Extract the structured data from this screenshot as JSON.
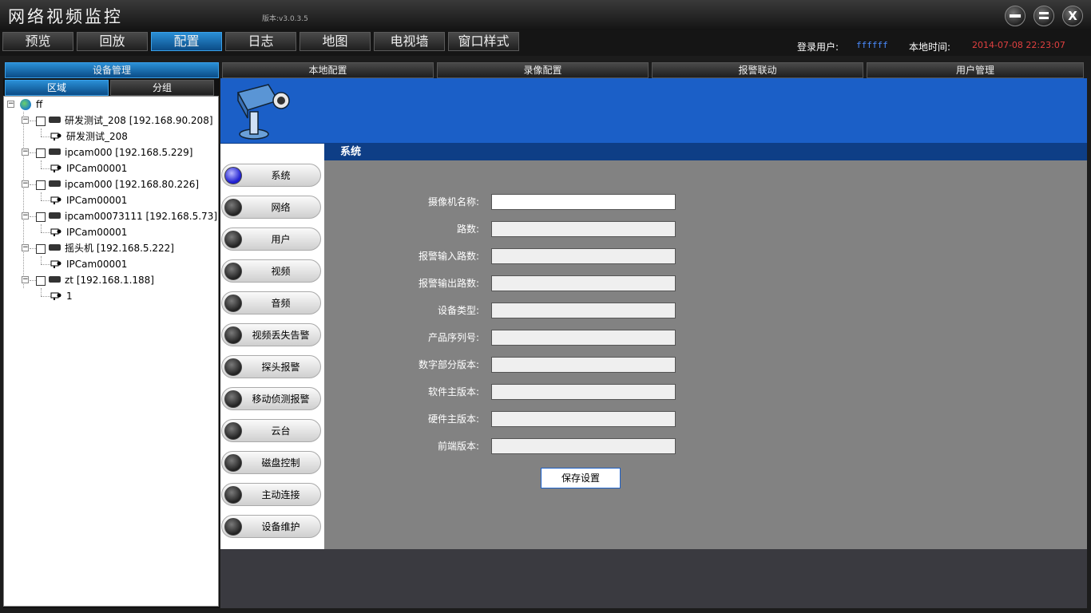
{
  "window": {
    "title": "网络视频监控",
    "version": "版本:v3.0.3.5",
    "min_icon": "minimize-icon",
    "restore_icon": "restore-icon",
    "close_label": "X"
  },
  "nav": {
    "tabs": [
      "预览",
      "回放",
      "配置",
      "日志",
      "地图",
      "电视墙",
      "窗口样式"
    ],
    "active": "配置",
    "user_label": "登录用户:",
    "user_value": "ffffff",
    "time_label": "本地时间:",
    "time_value": "2014-07-08 22:23:07"
  },
  "subtabs": [
    "设备管理",
    "本地配置",
    "录像配置",
    "报警联动",
    "用户管理"
  ],
  "left": {
    "tabs": [
      "区域",
      "分组"
    ],
    "root": "ff",
    "devices": [
      {
        "name": "研发测试_208 [192.168.90.208]",
        "channel": "研发测试_208"
      },
      {
        "name": "ipcam000 [192.168.5.229]",
        "channel": "IPCam00001"
      },
      {
        "name": "ipcam000 [192.168.80.226]",
        "channel": "IPCam00001"
      },
      {
        "name": "ipcam00073111 [192.168.5.73]",
        "channel": "IPCam00001"
      },
      {
        "name": "摇头机 [192.168.5.222]",
        "channel": "IPCam00001"
      },
      {
        "name": "zt [192.168.1.188]",
        "channel": "1"
      }
    ]
  },
  "menu": [
    "系统",
    "网络",
    "用户",
    "视频",
    "音频",
    "视频丢失告警",
    "探头报警",
    "移动侦测报警",
    "云台",
    "磁盘控制",
    "主动连接",
    "设备维护"
  ],
  "section": {
    "title": "系统",
    "fields": [
      {
        "label": "摄像机名称:",
        "value": ""
      },
      {
        "label": "路数:",
        "value": ""
      },
      {
        "label": "报警输入路数:",
        "value": ""
      },
      {
        "label": "报警输出路数:",
        "value": ""
      },
      {
        "label": "设备类型:",
        "value": ""
      },
      {
        "label": "产品序列号:",
        "value": ""
      },
      {
        "label": "数字部分版本:",
        "value": ""
      },
      {
        "label": "软件主版本:",
        "value": ""
      },
      {
        "label": "硬件主版本:",
        "value": ""
      },
      {
        "label": "前端版本:",
        "value": ""
      }
    ],
    "save_label": "保存设置"
  },
  "colors": {
    "accent": "#1b5fc7",
    "user_color": "#4a8cff",
    "time_color": "#e04040"
  }
}
